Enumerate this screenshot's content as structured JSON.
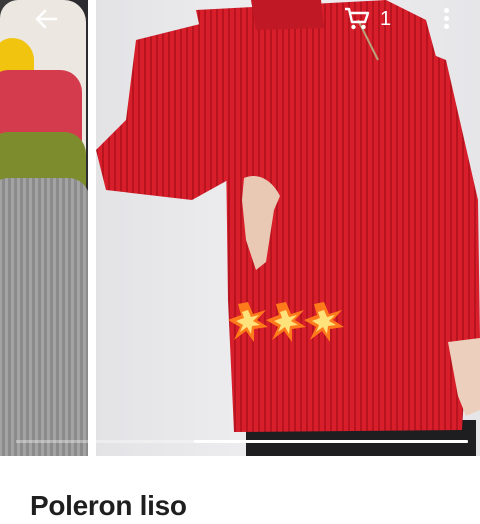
{
  "header": {
    "back_icon": "arrow-left-icon",
    "cart_icon": "shopping-cart-icon",
    "cart_count": "1",
    "more_icon": "more-vertical-icon"
  },
  "gallery": {
    "previous_image": "stacked-sweaters-photo",
    "main_image": "red-knit-sweater-photo",
    "sticker_icon": "sparkle-burst-sticker",
    "colors": {
      "sweater": "#d71e2a",
      "background": "#ffffff"
    }
  },
  "product": {
    "title": "Poleron liso"
  }
}
